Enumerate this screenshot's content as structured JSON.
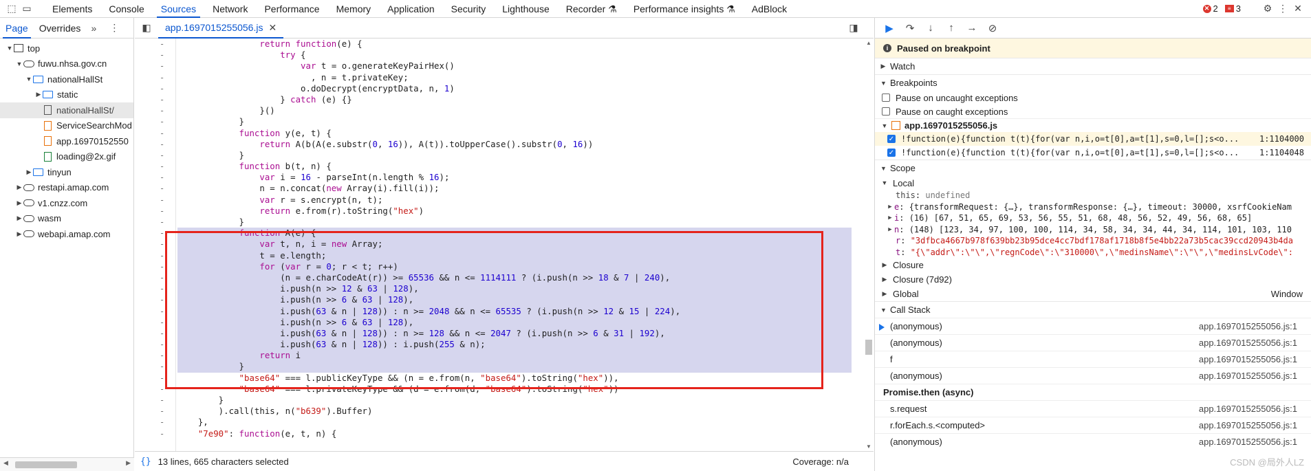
{
  "toolbar": {
    "tabs": [
      "Elements",
      "Console",
      "Sources",
      "Network",
      "Performance",
      "Memory",
      "Application",
      "Security",
      "Lighthouse",
      "Recorder",
      "Performance insights",
      "AdBlock"
    ],
    "active_tab": "Sources",
    "recorder_label": "Recorder",
    "perf_insights_label": "Performance insights",
    "error_count": "2",
    "issue_count": "3"
  },
  "navigator": {
    "tabs": [
      "Page",
      "Overrides"
    ],
    "tree": [
      {
        "label": "top",
        "indent": 0,
        "kind": "frame",
        "expanded": true
      },
      {
        "label": "fuwu.nhsa.gov.cn",
        "indent": 1,
        "kind": "cloud",
        "expanded": true
      },
      {
        "label": "nationalHallSt",
        "indent": 2,
        "kind": "folder",
        "expanded": true
      },
      {
        "label": "static",
        "indent": 3,
        "kind": "folder",
        "expanded": false
      },
      {
        "label": "nationalHallSt/",
        "indent": 3,
        "kind": "file-plain",
        "selected": true
      },
      {
        "label": "ServiceSearchMod",
        "indent": 3,
        "kind": "file-orange"
      },
      {
        "label": "app.16970152550",
        "indent": 3,
        "kind": "file-orange"
      },
      {
        "label": "loading@2x.gif",
        "indent": 3,
        "kind": "file-green"
      },
      {
        "label": "tinyun",
        "indent": 2,
        "kind": "folder",
        "expanded": false
      },
      {
        "label": "restapi.amap.com",
        "indent": 1,
        "kind": "cloud",
        "expanded": false
      },
      {
        "label": "v1.cnzz.com",
        "indent": 1,
        "kind": "cloud",
        "expanded": false
      },
      {
        "label": "wasm",
        "indent": 1,
        "kind": "cloud",
        "expanded": false
      },
      {
        "label": "webapi.amap.com",
        "indent": 1,
        "kind": "cloud",
        "expanded": false
      }
    ]
  },
  "editor": {
    "file_tab": "app.1697015255056.js",
    "status_selection": "13 lines, 665 characters selected",
    "coverage": "Coverage: n/a",
    "lines": [
      "                return function(e) {",
      "                    try {",
      "                        var t = o.generateKeyPairHex()",
      "                          , n = t.privateKey;",
      "                        o.doDecrypt(encryptData, n, 1)",
      "                    } catch (e) {}",
      "                }()",
      "            }",
      "            function y(e, t) {",
      "                return A(b(A(e.substr(0, 16)), A(t)).toUpperCase().substr(0, 16))",
      "            }",
      "            function b(t, n) {",
      "                var i = 16 - parseInt(n.length % 16);",
      "                n = n.concat(new Array(i).fill(i));",
      "                var r = s.encrypt(n, t);",
      "                return e.from(r).toString(\"hex\")",
      "            }",
      "            function A(e) {",
      "                var t, n, i = new Array;",
      "                t = e.length;",
      "                for (var r = 0; r < t; r++)",
      "                    (n = e.charCodeAt(r)) >= 65536 && n <= 1114111 ? (i.push(n >> 18 & 7 | 240),",
      "                    i.push(n >> 12 & 63 | 128),",
      "                    i.push(n >> 6 & 63 | 128),",
      "                    i.push(63 & n | 128)) : n >= 2048 && n <= 65535 ? (i.push(n >> 12 & 15 | 224),",
      "                    i.push(n >> 6 & 63 | 128),",
      "                    i.push(63 & n | 128)) : n >= 128 && n <= 2047 ? (i.push(n >> 6 & 31 | 192),",
      "                    i.push(63 & n | 128)) : i.push(255 & n);",
      "                return i",
      "            }",
      "            \"base64\" === l.publicKeyType && (n = e.from(n, \"base64\").toString(\"hex\")),",
      "            \"base64\" === l.privateKeyType && (d = e.from(d, \"base64\").toString(\"hex\"))",
      "        }",
      "        ).call(this, n(\"b639\").Buffer)",
      "    },",
      "    \"7e90\": function(e, t, n) {"
    ]
  },
  "debugger": {
    "paused_text": "Paused on breakpoint",
    "watch_label": "Watch",
    "breakpoints_label": "Breakpoints",
    "pause_uncaught": "Pause on uncaught exceptions",
    "pause_caught": "Pause on caught exceptions",
    "bp_file": "app.1697015255056.js",
    "bp_items": [
      {
        "code": "!function(e){function t(t){for(var n,i,o=t[0],a=t[1],s=0,l=[];s<o...",
        "loc": "1:1104000"
      },
      {
        "code": "!function(e){function t(t){for(var n,i,o=t[0],a=t[1],s=0,l=[];s<o...",
        "loc": "1:1104048"
      }
    ],
    "scope_label": "Scope",
    "local_label": "Local",
    "scope_vars": [
      {
        "key": "this",
        "val": "undefined",
        "expandable": false
      },
      {
        "key": "e",
        "val": "{transformRequest: {…}, transformResponse: {…}, timeout: 30000, xsrfCookieNam",
        "expandable": true
      },
      {
        "key": "i",
        "val": "(16) [67, 51, 65, 69, 53, 56, 55, 51, 68, 48, 56, 52, 49, 56, 68, 65]",
        "expandable": true
      },
      {
        "key": "n",
        "val": "(148) [123, 34, 97, 100, 100, 114, 34, 58, 34, 34, 44, 34, 114, 101, 103, 110",
        "expandable": true
      },
      {
        "key": "r",
        "val": "\"3dfbca4667b978f639bb23b95dce4cc7bdf178af1718b8f5e4bb22a73b5cac39ccd20943b4da",
        "expandable": false,
        "string": true
      },
      {
        "key": "t",
        "val": "\"{\\\"addr\\\":\\\"\\\",\\\"regnCode\\\":\\\"310000\\\",\\\"medinsName\\\":\\\"\\\",\\\"medinsLvCode\\\":",
        "expandable": false,
        "string": true
      }
    ],
    "closure_label": "Closure",
    "closure2_label": "Closure (7d92)",
    "global_label": "Global",
    "global_val": "Window",
    "callstack_label": "Call Stack",
    "callstack": [
      {
        "name": "(anonymous)",
        "loc": "app.1697015255056.js:1",
        "current": true
      },
      {
        "name": "(anonymous)",
        "loc": "app.1697015255056.js:1"
      },
      {
        "name": "f",
        "loc": "app.1697015255056.js:1"
      },
      {
        "name": "(anonymous)",
        "loc": "app.1697015255056.js:1"
      },
      {
        "name": "Promise.then (async)",
        "loc": "",
        "async": true
      },
      {
        "name": "s.request",
        "loc": "app.1697015255056.js:1"
      },
      {
        "name": "r.forEach.s.<computed>",
        "loc": "app.1697015255056.js:1"
      },
      {
        "name": "(anonymous)",
        "loc": "app.1697015255056.js:1"
      }
    ],
    "watermark": "CSDN @局外人LZ"
  }
}
